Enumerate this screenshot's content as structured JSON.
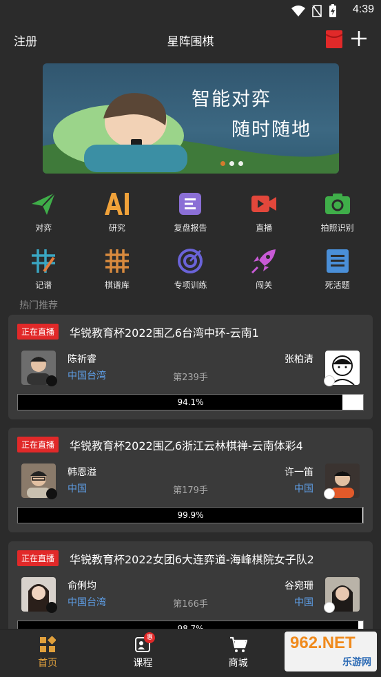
{
  "status_bar": {
    "time": "4:39"
  },
  "header": {
    "register": "注册",
    "title": "星阵围棋"
  },
  "banner": {
    "line1": "智能对弈",
    "line2": "随时随地"
  },
  "features": [
    {
      "label": "对弈",
      "icon": "paper-plane-icon",
      "color": "#3fae49"
    },
    {
      "label": "研究",
      "icon": "ai-icon",
      "color": "#f0a23a"
    },
    {
      "label": "复盘报告",
      "icon": "report-icon",
      "color": "#8b6fd6"
    },
    {
      "label": "直播",
      "icon": "video-icon",
      "color": "#e2473b"
    },
    {
      "label": "拍照识别",
      "icon": "camera-icon",
      "color": "#3fae49"
    },
    {
      "label": "记谱",
      "icon": "record-icon",
      "color": "#3aa6c2"
    },
    {
      "label": "棋谱库",
      "icon": "grid-icon",
      "color": "#d88a3e"
    },
    {
      "label": "专项训练",
      "icon": "target-icon",
      "color": "#6a63d8"
    },
    {
      "label": "闯关",
      "icon": "rocket-icon",
      "color": "#c85ad6"
    },
    {
      "label": "死活题",
      "icon": "book-icon",
      "color": "#4a8fd8"
    }
  ],
  "section": {
    "title": "热门推荐"
  },
  "matches": [
    {
      "badge": "正在直播",
      "title": "华锐教育杯2022围乙6台湾中环-云南1",
      "black_name": "陈祈睿",
      "black_loc": "中国台湾",
      "white_name": "张柏清",
      "white_loc": "",
      "moves": "第239手",
      "win_rate": 0.941,
      "win_text": "94.1%"
    },
    {
      "badge": "正在直播",
      "title": "华锐教育杯2022围乙6浙江云林棋禅-云南体彩4",
      "black_name": "韩恩溢",
      "black_loc": "中国",
      "white_name": "许一笛",
      "white_loc": "中国",
      "moves": "第179手",
      "win_rate": 0.999,
      "win_text": "99.9%"
    },
    {
      "badge": "正在直播",
      "title": "华锐教育杯2022女团6大连弈道-海峰棋院女子队2",
      "black_name": "俞俐均",
      "black_loc": "中国台湾",
      "white_name": "谷宛珊",
      "white_loc": "中国",
      "moves": "第166手",
      "win_rate": 0.987,
      "win_text": "98.7%"
    }
  ],
  "tabs": [
    {
      "label": "首页",
      "active": true
    },
    {
      "label": "课程",
      "badge": "惠"
    },
    {
      "label": "商城"
    },
    {
      "label": ""
    }
  ],
  "watermark": {
    "brand": "962.NET",
    "site": "乐游网"
  }
}
